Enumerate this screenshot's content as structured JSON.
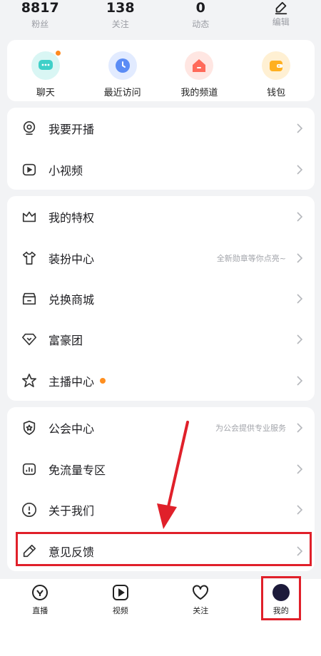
{
  "stats": [
    {
      "value": "8817",
      "label": "粉丝"
    },
    {
      "value": "138",
      "label": "关注"
    },
    {
      "value": "0",
      "label": "动态"
    },
    {
      "label": "编辑",
      "icon": "edit-icon"
    }
  ],
  "quick": [
    {
      "label": "聊天",
      "icon": "chat-icon",
      "color": "#3fd0c8"
    },
    {
      "label": "最近访问",
      "icon": "clock-icon",
      "color": "#5b8cf5"
    },
    {
      "label": "我的频道",
      "icon": "home-icon",
      "color": "#ff6a5a"
    },
    {
      "label": "钱包",
      "icon": "wallet-icon",
      "color": "#ffb020"
    }
  ],
  "group1": [
    {
      "label": "我要开播",
      "icon": "broadcast-icon"
    },
    {
      "label": "小视频",
      "icon": "video-icon"
    }
  ],
  "group2": [
    {
      "label": "我的特权",
      "icon": "crown-icon",
      "sub": ""
    },
    {
      "label": "装扮中心",
      "icon": "shirt-icon",
      "sub": "全新勋章等你点亮~"
    },
    {
      "label": "兑换商城",
      "icon": "store-icon",
      "sub": ""
    },
    {
      "label": "富豪团",
      "icon": "diamond-icon",
      "sub": ""
    },
    {
      "label": "主播中心",
      "icon": "star-icon",
      "sub": ""
    }
  ],
  "group3": [
    {
      "label": "公会中心",
      "icon": "shield-icon",
      "sub": "为公会提供专业服务"
    },
    {
      "label": "免流量专区",
      "icon": "chart-icon",
      "sub": ""
    },
    {
      "label": "关于我们",
      "icon": "info-icon",
      "sub": ""
    },
    {
      "label": "意见反馈",
      "icon": "pen-icon",
      "sub": ""
    }
  ],
  "tabs": [
    {
      "label": "直播",
      "icon": "live-icon"
    },
    {
      "label": "视频",
      "icon": "play-icon"
    },
    {
      "label": "关注",
      "icon": "heart-icon"
    },
    {
      "label": "我的",
      "icon": "avatar-icon"
    }
  ],
  "colors": {
    "accent_dot": "#ff8a1f",
    "highlight": "#e0202a"
  }
}
